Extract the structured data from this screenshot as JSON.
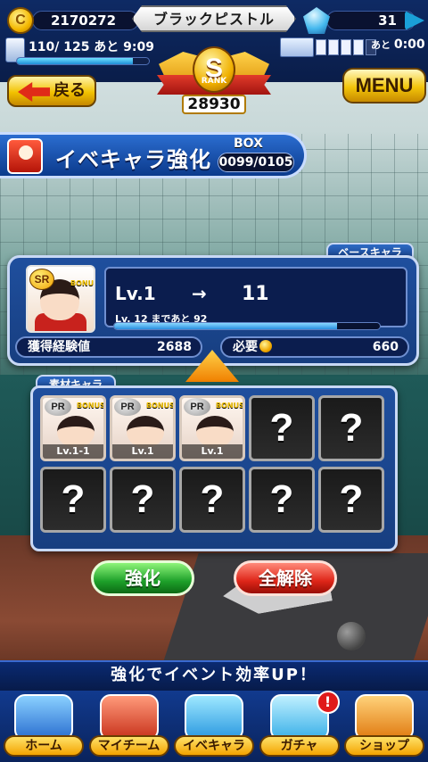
{
  "status": {
    "coins": "2170272",
    "player_name": "ブラックピストル",
    "gems": "31",
    "stamina_text": "110/ 125 あと  9:09",
    "stamina_fraction": 0.88,
    "ticket_time_prefix": "あと",
    "ticket_time": "0:00",
    "tickets_filled": 4,
    "tickets_total": 5
  },
  "rank": {
    "letter": "S",
    "label": "RANK",
    "score": "28930"
  },
  "nav": {
    "back_label": "戻る",
    "menu_label": "MENU"
  },
  "title": {
    "text": "イベキャラ強化",
    "box_label": "BOX",
    "box_value": "0099/0105"
  },
  "base": {
    "tag": "ベースキャラ",
    "rarity": "SR",
    "bonus": "BONUS",
    "lv_label": "Lv.1",
    "arrow": "→",
    "lv_to": "11",
    "next_text": "Lv. 12  まであと 92",
    "progress_fraction": 0.84,
    "exp_label": "獲得経験値",
    "exp_value": "2688",
    "need_label": "必要",
    "need_value": "660"
  },
  "material": {
    "tag": "素材キャラ",
    "slots": [
      {
        "filled": true,
        "rarity": "PR",
        "bonus": "BONUS",
        "level": "Lv.1-1"
      },
      {
        "filled": true,
        "rarity": "PR",
        "bonus": "BONUS",
        "level": "Lv.1"
      },
      {
        "filled": true,
        "rarity": "PR",
        "bonus": "BONUS",
        "level": "Lv.1"
      },
      {
        "filled": false,
        "mark": "?"
      },
      {
        "filled": false,
        "mark": "?"
      },
      {
        "filled": false,
        "mark": "?"
      },
      {
        "filled": false,
        "mark": "?"
      },
      {
        "filled": false,
        "mark": "?"
      },
      {
        "filled": false,
        "mark": "?"
      },
      {
        "filled": false,
        "mark": "?"
      }
    ]
  },
  "actions": {
    "enhance_label": "強化",
    "clear_label": "全解除"
  },
  "tip": "強化でイベント効率UP！",
  "tabs": [
    {
      "id": "home",
      "label": "ホーム",
      "icon": "notebook-icon"
    },
    {
      "id": "team",
      "label": "マイチーム",
      "icon": "team-icon"
    },
    {
      "id": "event",
      "label": "イベキャラ",
      "icon": "character-icon"
    },
    {
      "id": "gacha",
      "label": "ガチャ",
      "icon": "gacha-icon",
      "alert": "!"
    },
    {
      "id": "shop",
      "label": "ショップ",
      "icon": "shop-icon"
    }
  ]
}
